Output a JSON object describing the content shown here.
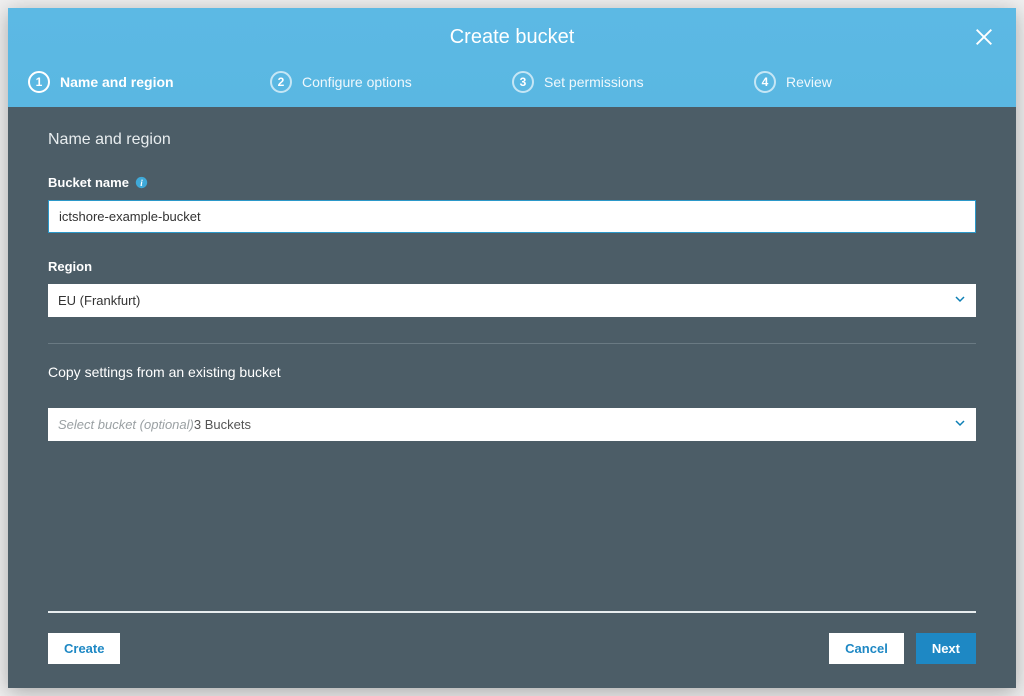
{
  "modal": {
    "title": "Create bucket"
  },
  "stepper": {
    "steps": [
      {
        "num": "1",
        "label": "Name and region",
        "active": true
      },
      {
        "num": "2",
        "label": "Configure options",
        "active": false
      },
      {
        "num": "3",
        "label": "Set permissions",
        "active": false
      },
      {
        "num": "4",
        "label": "Review",
        "active": false
      }
    ]
  },
  "form": {
    "section_title": "Name and region",
    "bucket_name": {
      "label": "Bucket name",
      "value": "ictshore-example-bucket"
    },
    "region": {
      "label": "Region",
      "value": "EU (Frankfurt)"
    },
    "copy_section_title": "Copy settings from an existing bucket",
    "copy_settings": {
      "placeholder": "Select bucket (optional)",
      "count_label": "3 Buckets"
    }
  },
  "footer": {
    "create": "Create",
    "cancel": "Cancel",
    "next": "Next"
  }
}
